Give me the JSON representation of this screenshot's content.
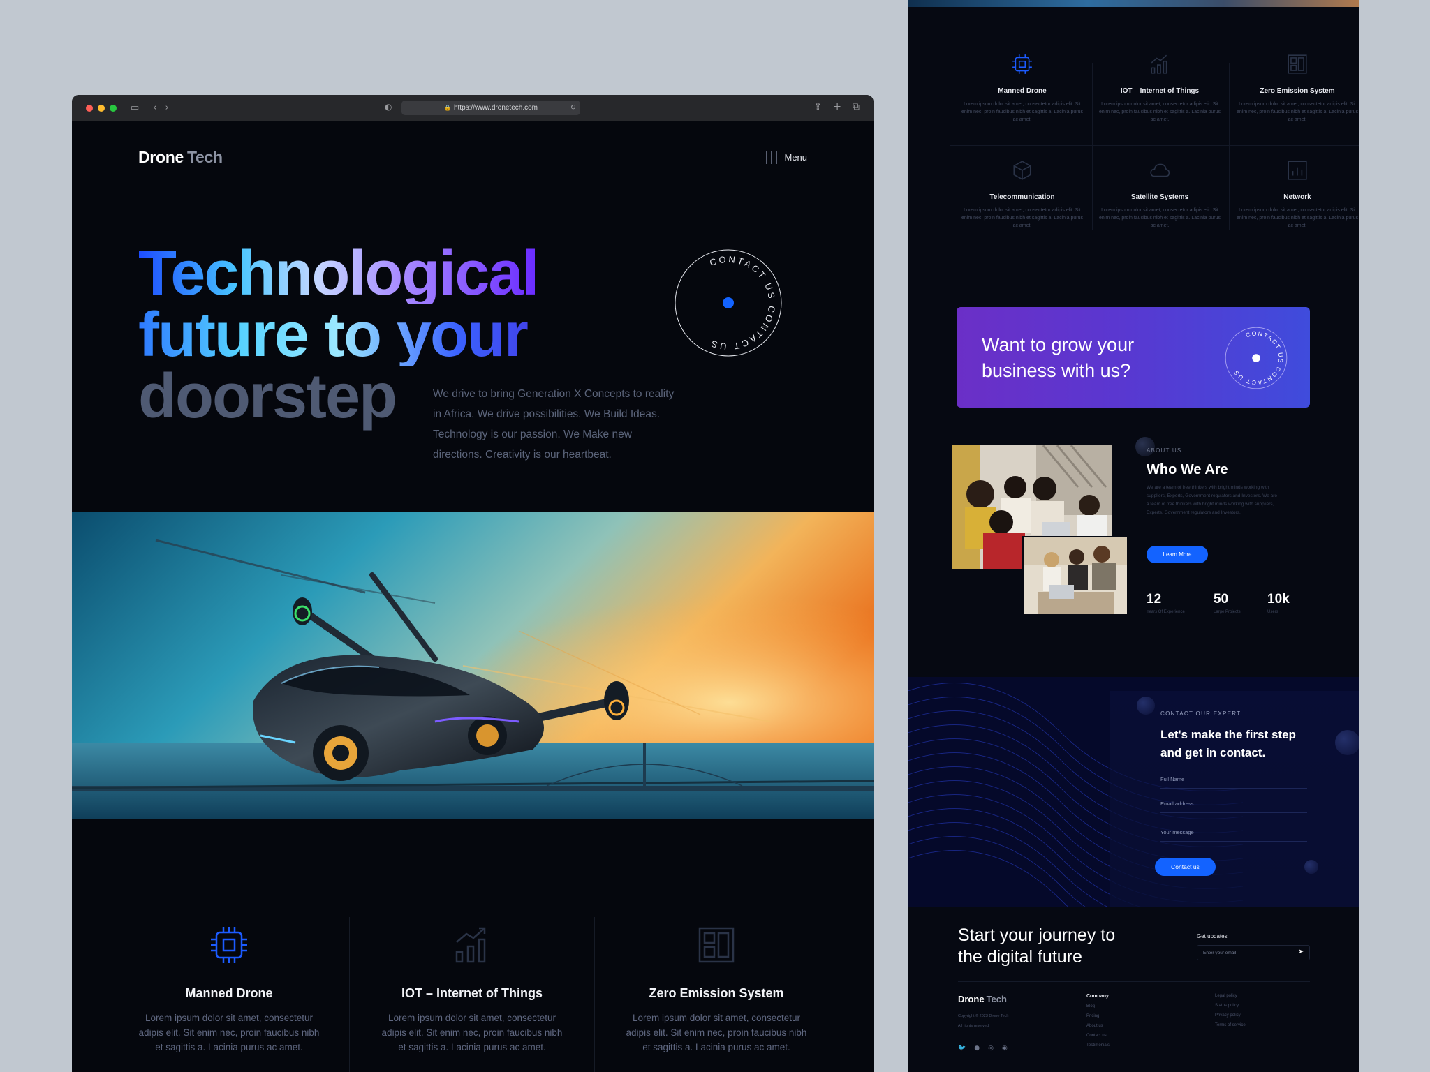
{
  "browser": {
    "url": "https://www.dronetech.com"
  },
  "nav": {
    "logo_bold": "Drone",
    "logo_light": "Tech",
    "menu_label": "Menu"
  },
  "hero": {
    "title_line1": "Technological",
    "title_line2": "future to your",
    "title_line3": "doorstep",
    "description": "We drive to bring Generation X Concepts to reality in Africa. We drive possibilities. We Build Ideas. Technology is our passion. We Make new directions. Creativity is our heartbeat.",
    "badge_text": "CONTACT US CONTACT US"
  },
  "features": [
    {
      "title": "Manned Drone",
      "icon": "chip-icon",
      "text": "Lorem ipsum dolor sit amet, consectetur adipis elit. Sit enim nec, proin faucibus nibh et sagittis a. Lacinia purus ac amet."
    },
    {
      "title": "IOT – Internet of Things",
      "icon": "growth-chart-icon",
      "text": "Lorem ipsum dolor sit amet, consectetur adipis elit. Sit enim nec, proin faucibus nibh et sagittis a. Lacinia purus ac amet."
    },
    {
      "title": "Zero Emission System",
      "icon": "panel-grid-icon",
      "text": "Lorem ipsum dolor sit amet, consectetur adipis elit. Sit enim nec, proin faucibus nibh et sagittis a. Lacinia purus ac amet."
    }
  ],
  "right": {
    "services": [
      {
        "title": "Manned Drone",
        "icon": "chip-icon",
        "text": "Lorem ipsum dolor sit amet, consectetur adipis elit. Sit enim nec, proin faucibus nibh et sagittis a. Lacinia purus ac amet."
      },
      {
        "title": "IOT – Internet of Things",
        "icon": "growth-chart-icon",
        "text": "Lorem ipsum dolor sit amet, consectetur adipis elit. Sit enim nec, proin faucibus nibh et sagittis a. Lacinia purus ac amet."
      },
      {
        "title": "Zero Emission System",
        "icon": "panel-grid-icon",
        "text": "Lorem ipsum dolor sit amet, consectetur adipis elit. Sit enim nec, proin faucibus nibh et sagittis a. Lacinia purus ac amet."
      },
      {
        "title": "Telecommunication",
        "icon": "cube-icon",
        "text": "Lorem ipsum dolor sit amet, consectetur adipis elit. Sit enim nec, proin faucibus nibh et sagittis a. Lacinia purus ac amet."
      },
      {
        "title": "Satellite Systems",
        "icon": "cloud-icon",
        "text": "Lorem ipsum dolor sit amet, consectetur adipis elit. Sit enim nec, proin faucibus nibh et sagittis a. Lacinia purus ac amet."
      },
      {
        "title": "Network",
        "icon": "bar-chart-icon",
        "text": "Lorem ipsum dolor sit amet, consectetur adipis elit. Sit enim nec, proin faucibus nibh et sagittis a. Lacinia purus ac amet."
      }
    ],
    "grow_line1": "Want to grow your",
    "grow_line2": "business with us?",
    "about": {
      "eyebrow": "ABOUT US",
      "title": "Who We Are",
      "text": "We are a team of free thinkers with bright minds working with suppliers, Experts, Government regulators and Investors. We are a team of free thinkers with bright minds working with suppliers, Experts, Government regulators and Investors.",
      "button": "Learn More",
      "stats": [
        {
          "value": "12",
          "label": "Years Of Experience"
        },
        {
          "value": "50",
          "label": "Large Projects"
        },
        {
          "value": "10k",
          "label": "Users"
        }
      ]
    },
    "contact": {
      "eyebrow": "CONTACT OUR EXPERT",
      "title": "Let's make the first step and get in contact.",
      "field_name": "Full Name",
      "field_email": "Email address",
      "field_message": "Your message",
      "button": "Contact us"
    },
    "footer": {
      "cta_line1": "Start your journey to",
      "cta_line2": "the digital future",
      "updates_label": "Get updates",
      "email_placeholder": "Enter your email",
      "logo_bold": "Drone",
      "logo_light": "Tech",
      "copyright": "Copyright © 2023 Drone Tech",
      "rights": "All rights reserved",
      "company_heading": "Company",
      "company_links": [
        "Blog",
        "Pricing",
        "About us",
        "Contact us",
        "Testimonials"
      ],
      "legal_links": [
        "Legal policy",
        "Status policy",
        "Privacy policy",
        "Terms of service"
      ]
    }
  }
}
